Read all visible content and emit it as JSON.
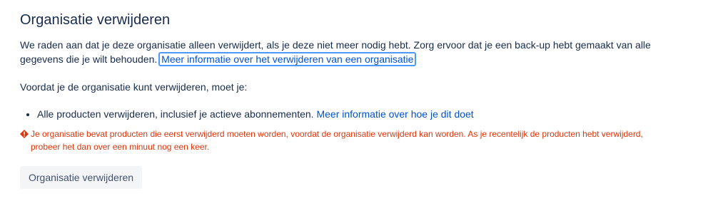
{
  "section": {
    "title": "Organisatie verwijderen",
    "intro_text": "We raden aan dat je deze organisatie alleen verwijdert, als je deze niet meer nodig hebt. Zorg ervoor dat je een back-up hebt gemaakt van alle gegevens die je wilt behouden.",
    "intro_link": "Meer informatie over het verwijderen van een organisatie",
    "pre_list_text": "Voordat je de organisatie kunt verwijderen, moet je:",
    "requirements": [
      {
        "text": "Alle producten verwijderen, inclusief je actieve abonnementen.",
        "link": "Meer informatie over hoe je dit doet"
      }
    ],
    "error_message": "Je organisatie bevat producten die eerst verwijderd moeten worden, voordat de organisatie verwijderd kan worden. As je recentelijk de producten hebt verwijderd, probeer het dan over een minuut nog een keer.",
    "error_icon": "error-icon",
    "delete_button_label": "Organisatie verwijderen"
  },
  "colors": {
    "text": "#172b4d",
    "link": "#0052cc",
    "focus_ring": "#4c9aff",
    "error": "#de350b",
    "button_bg": "#f4f5f7",
    "button_text": "#42526e"
  }
}
